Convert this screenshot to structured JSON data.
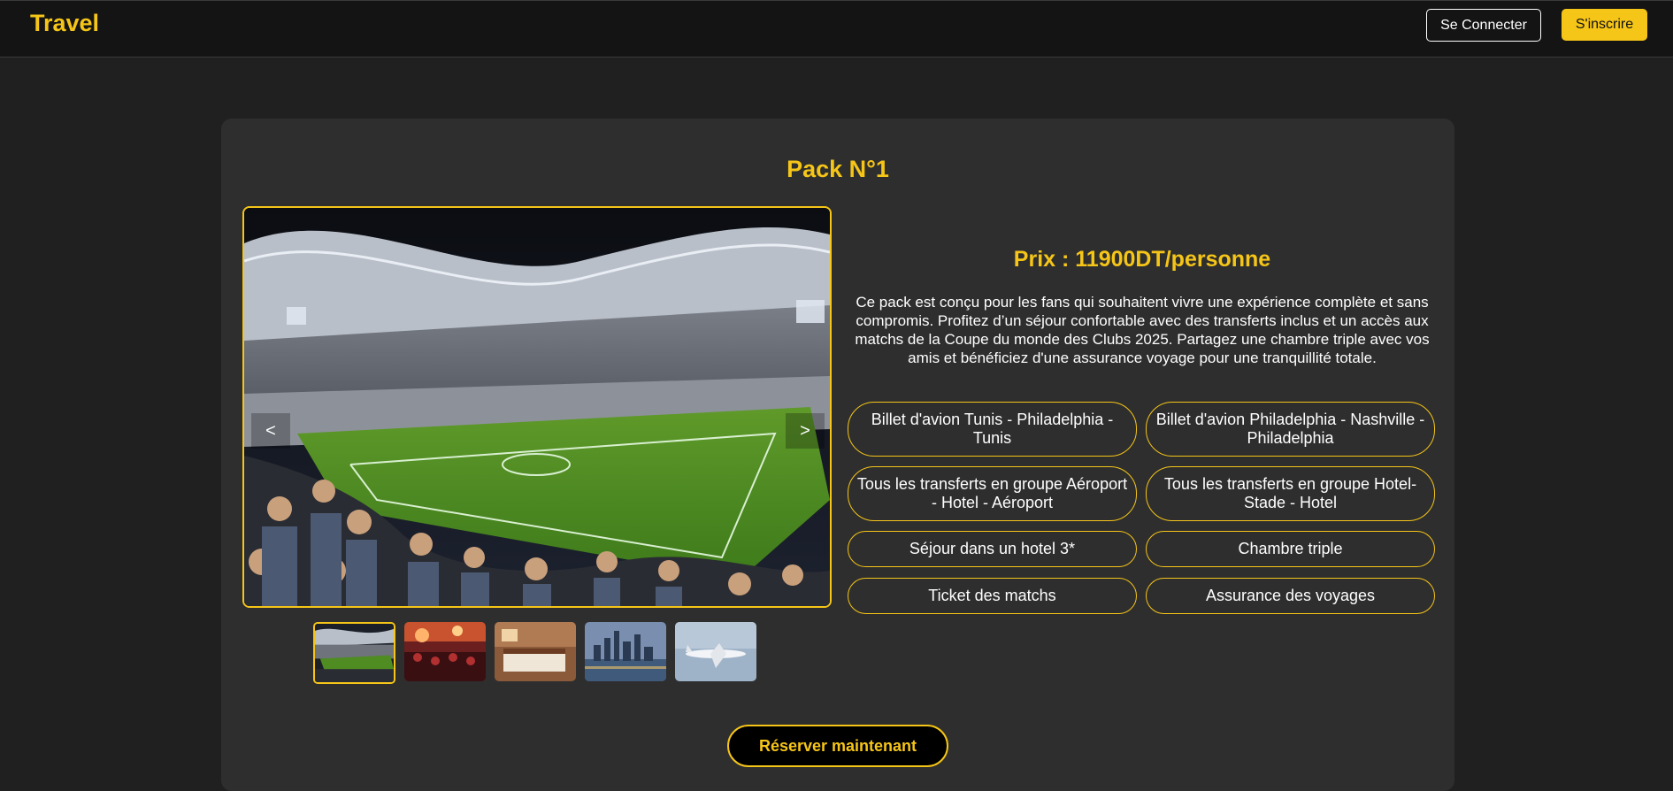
{
  "header": {
    "brand": "Travel",
    "login_label": "Se Connecter",
    "signup_label": "S'inscrire"
  },
  "pack": {
    "title": "Pack N°1",
    "price": "Prix : 11900DT/personne",
    "description": "Ce pack est conçu pour les fans qui souhaitent vivre une expérience complète et sans compromis. Profitez d’un séjour confortable avec des transferts inclus et un accès aux matchs de la Coupe du monde des Clubs 2025. Partagez une chambre triple avec vos amis et bénéficiez d'une assurance voyage pour une tranquillité totale.",
    "features": [
      "Billet d'avion Tunis - Philadelphia - Tunis",
      "Billet d'avion Philadelphia - Nashville - Philadelphia",
      "Tous les transferts en groupe Aéroport - Hotel - Aéroport",
      "Tous les transferts en groupe Hotel-Stade - Hotel",
      "Séjour dans un hotel 3*",
      "Chambre triple",
      "Ticket des matchs",
      "Assurance des voyages"
    ],
    "reserve_label": "Réserver maintenant"
  },
  "gallery": {
    "prev_label": "<",
    "next_label": ">",
    "thumbnails": [
      "stadium-photo",
      "crowd-fans-photo",
      "hotel-room-photo",
      "city-skyline-photo",
      "airplane-photo"
    ],
    "active_index": 0
  },
  "colors": {
    "accent": "#f5c518",
    "background": "#202020",
    "card": "#2e2e2e",
    "header": "#141414"
  }
}
